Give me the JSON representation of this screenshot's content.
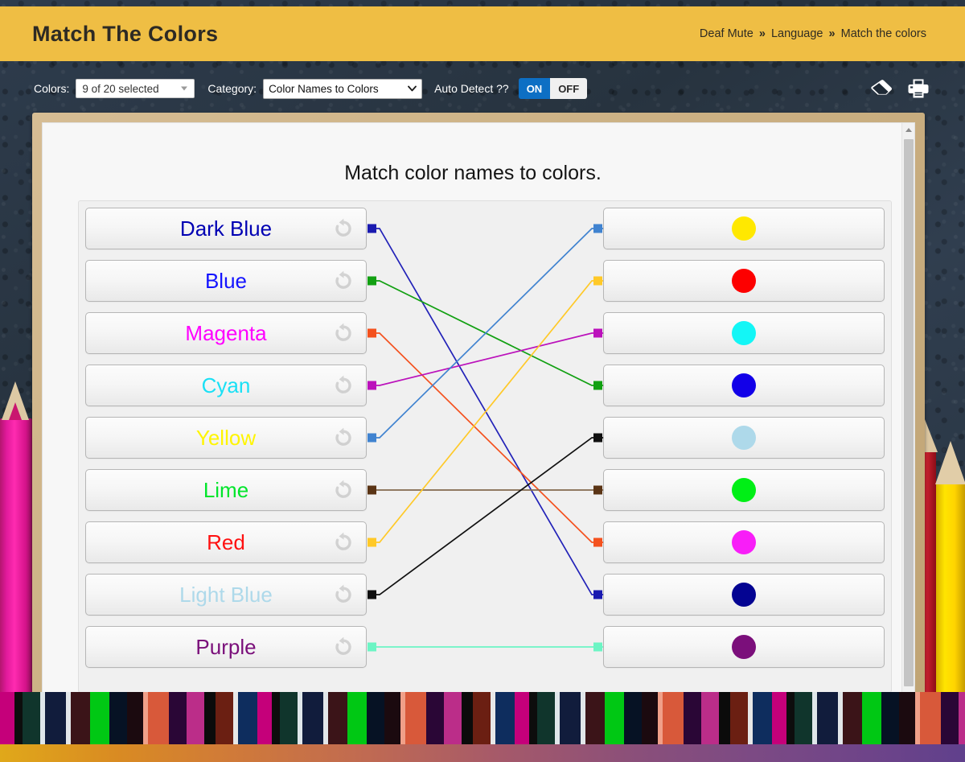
{
  "header": {
    "title": "Match The Colors",
    "breadcrumb": {
      "items": [
        "Deaf Mute",
        "Language",
        "Match the colors"
      ],
      "separator": "»"
    }
  },
  "toolbar": {
    "colors_label": "Colors:",
    "colors_value": "9 of 20 selected",
    "category_label": "Category:",
    "category_value": "Color Names to Colors",
    "auto_detect_label": "Auto Detect ??",
    "toggle_on": "ON",
    "toggle_off": "OFF",
    "toggle_state": "ON",
    "on_color": "#0d6fc4",
    "icons": [
      "eraser-icon",
      "printer-icon"
    ]
  },
  "game": {
    "title": "Match color names to colors.",
    "left_items": [
      {
        "label": "Dark Blue",
        "text_color": "#0000b3",
        "nub_color": "#1a1ab0"
      },
      {
        "label": "Blue",
        "text_color": "#1414ff",
        "nub_color": "#12a012"
      },
      {
        "label": "Magenta",
        "text_color": "#ff00ff",
        "nub_color": "#f4511e"
      },
      {
        "label": "Cyan",
        "text_color": "#1ae0f5",
        "nub_color": "#bb11bb"
      },
      {
        "label": "Yellow",
        "text_color": "#fff500",
        "nub_color": "#4083d0"
      },
      {
        "label": "Lime",
        "text_color": "#00e52b",
        "nub_color": "#5a3415"
      },
      {
        "label": "Red",
        "text_color": "#ff1111",
        "nub_color": "#ffc928"
      },
      {
        "label": "Light Blue",
        "text_color": "#aed9ea",
        "nub_color": "#101010"
      },
      {
        "label": "Purple",
        "text_color": "#7a0f7a",
        "nub_color": "#6cf5c4"
      }
    ],
    "right_items": [
      {
        "swatch_color": "#ffe800",
        "swatch_name": "yellow-swatch",
        "nub_color": "#4083d0"
      },
      {
        "swatch_color": "#fd0000",
        "swatch_name": "red-swatch",
        "nub_color": "#ffc928"
      },
      {
        "swatch_color": "#13f6f6",
        "swatch_name": "cyan-swatch",
        "nub_color": "#bb11bb"
      },
      {
        "swatch_color": "#1200e8",
        "swatch_name": "blue-swatch",
        "nub_color": "#12a012"
      },
      {
        "swatch_color": "#aed9ea",
        "swatch_name": "light-blue-swatch",
        "nub_color": "#101010"
      },
      {
        "swatch_color": "#00ef16",
        "swatch_name": "lime-swatch",
        "nub_color": "#5a3415"
      },
      {
        "swatch_color": "#f81ef8",
        "swatch_name": "magenta-swatch",
        "nub_color": "#f4511e"
      },
      {
        "swatch_color": "#040492",
        "swatch_name": "dark-blue-swatch",
        "nub_color": "#1a1ab0"
      },
      {
        "swatch_color": "#7b0f7b",
        "swatch_name": "purple-swatch",
        "nub_color": "#6cf5c4"
      }
    ],
    "connections": [
      {
        "from": 0,
        "to": 7,
        "color": "#2222b8"
      },
      {
        "from": 1,
        "to": 3,
        "color": "#12a012"
      },
      {
        "from": 2,
        "to": 6,
        "color": "#f4511e"
      },
      {
        "from": 3,
        "to": 2,
        "color": "#bb11bb"
      },
      {
        "from": 4,
        "to": 0,
        "color": "#4083d0"
      },
      {
        "from": 5,
        "to": 5,
        "color": "#836a4e"
      },
      {
        "from": 6,
        "to": 1,
        "color": "#ffc928"
      },
      {
        "from": 7,
        "to": 4,
        "color": "#101010"
      },
      {
        "from": 8,
        "to": 8,
        "color": "#6cf5c4"
      }
    ]
  }
}
